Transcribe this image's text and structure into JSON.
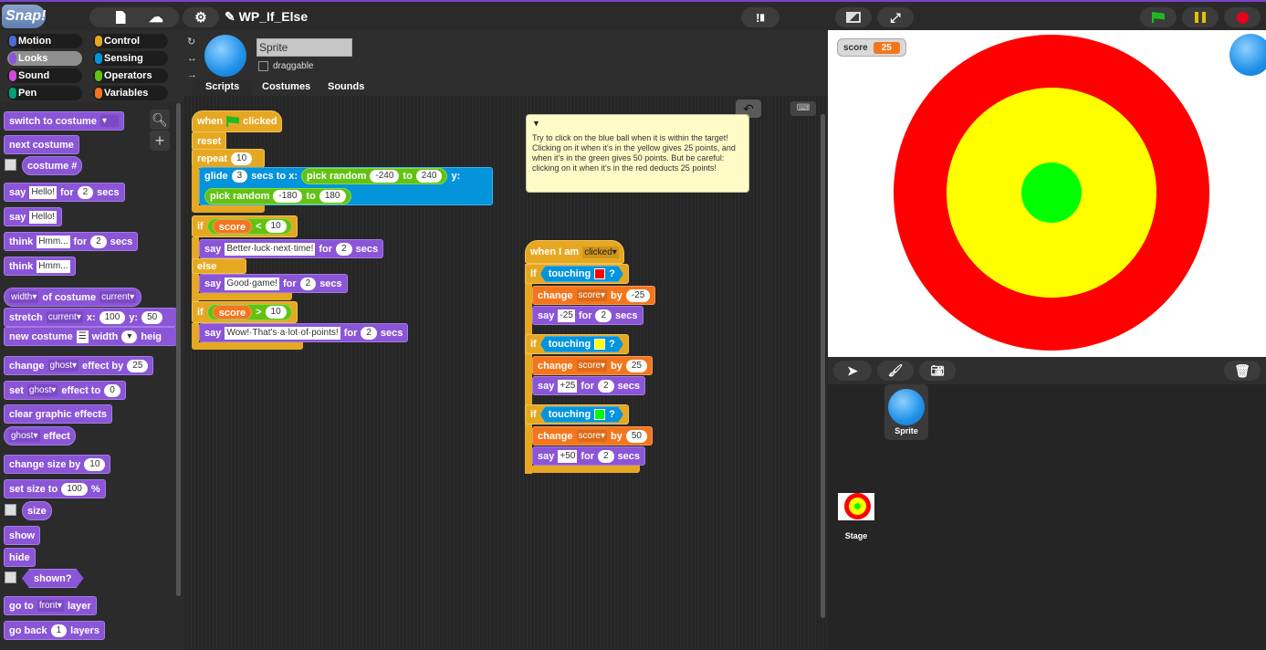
{
  "app": {
    "logo": "Snap!",
    "project_title": "WP_If_Else",
    "edit_icon": "pencil-icon"
  },
  "categories": [
    {
      "label": "Motion",
      "color": "#4a6cd4"
    },
    {
      "label": "Control",
      "color": "#e6a822"
    },
    {
      "label": "Looks",
      "color": "#8a55d7",
      "selected": true
    },
    {
      "label": "Sensing",
      "color": "#0494dc"
    },
    {
      "label": "Sound",
      "color": "#cf4ad9"
    },
    {
      "label": "Operators",
      "color": "#62c213"
    },
    {
      "label": "Pen",
      "color": "#00a178"
    },
    {
      "label": "Variables",
      "color": "#f3761d"
    }
  ],
  "palette": {
    "switch_to_costume": "switch to costume",
    "next_costume": "next costume",
    "costume_num": "costume #",
    "say": "say",
    "hello": "Hello!",
    "for": "for",
    "secs": "secs",
    "think": "think",
    "hmm": "Hmm...",
    "width_dd": "width",
    "of_costume": "of costume",
    "current": "current",
    "stretch": "stretch",
    "x": "x:",
    "y": "y:",
    "hundred": "100",
    "fifty": "50",
    "new_costume": "new costume",
    "width": "width",
    "height": "heig",
    "change": "change",
    "ghost": "ghost",
    "effect_by": "effect by",
    "twentyfive": "25",
    "set": "set",
    "effect_to": "effect to",
    "zero": "0",
    "clear_graphic_effects": "clear graphic effects",
    "effect": "effect",
    "change_size_by": "change size by",
    "ten": "10",
    "set_size_to": "set size to",
    "percent": "%",
    "size": "size",
    "show": "show",
    "hide": "hide",
    "shown": "shown?",
    "go_to": "go to",
    "front": "front",
    "layer": "layer",
    "go_back": "go back",
    "one": "1",
    "layers": "layers"
  },
  "sprite": {
    "name": "Sprite",
    "draggable_label": "draggable"
  },
  "tabs": [
    "Scripts",
    "Costumes",
    "Sounds"
  ],
  "script1": {
    "when": "when",
    "clicked": "clicked",
    "reset": "reset",
    "repeat": "repeat",
    "repeat_n": "10",
    "glide": "glide",
    "glide_secs": "3",
    "secs_to_x": "secs to x:",
    "pick_random": "pick random",
    "to": "to",
    "x_min": "-240",
    "x_max": "240",
    "y": "y:",
    "y_min": "-180",
    "y_max": "180",
    "if": "if",
    "score": "score",
    "lt": "<",
    "gt": ">",
    "ten": "10",
    "say": "say",
    "msg_better": "Better·luck·next·time!",
    "for": "for",
    "two": "2",
    "secs": "secs",
    "else": "else",
    "msg_good": "Good·game!",
    "msg_wow": "Wow!·That's·a·lot·of·points!"
  },
  "note": {
    "text": "Try to click on the blue ball when it is within the target! Clicking on it when it's in the yellow gives 25 points, and when it's in the green gives 50 points. But be careful: clicking on it when it's in the red deducts 25 points!"
  },
  "script2": {
    "when_i_am": "when I am",
    "clicked_dd": "clicked",
    "if": "if",
    "touching": "touching",
    "q": "?",
    "change": "change",
    "score": "score",
    "by": "by",
    "minus25": "-25",
    "plus25": "25",
    "fifty": "50",
    "say": "say",
    "say_m25": "-25",
    "say_p25": "+25",
    "say_p50": "+50",
    "for": "for",
    "two": "2",
    "secs": "secs",
    "colors": [
      "#ff0000",
      "#ffff00",
      "#00ff00"
    ]
  },
  "stage": {
    "watcher_label": "score",
    "watcher_value": "25",
    "ring_colors": [
      "#ff0000",
      "#ffff00",
      "#00ff00"
    ]
  },
  "corral": {
    "sprite_label": "Sprite",
    "stage_label": "Stage"
  }
}
